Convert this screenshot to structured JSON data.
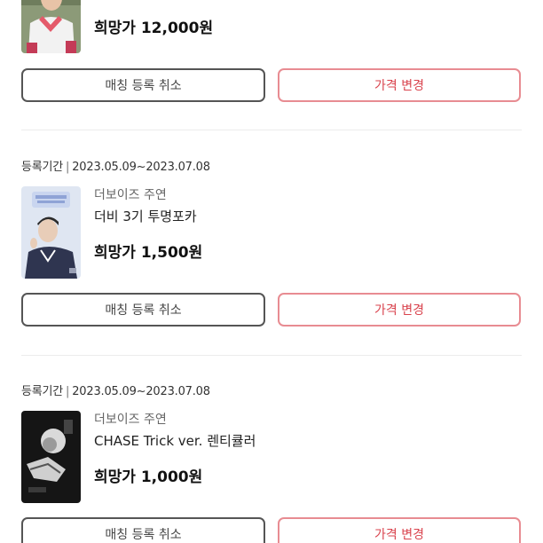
{
  "items": [
    {
      "price": "희망가 12,000원",
      "cancel_label": "매칭 등록 취소",
      "change_label": "가격 변경"
    },
    {
      "period_label": "등록기간",
      "period_sep": "|",
      "period_range": "2023.05.09~2023.07.08",
      "seller": "더보이즈 주연",
      "name": "더비 3기 투명포카",
      "price": "희망가 1,500원",
      "cancel_label": "매칭 등록 취소",
      "change_label": "가격 변경"
    },
    {
      "period_label": "등록기간",
      "period_sep": "|",
      "period_range": "2023.05.09~2023.07.08",
      "seller": "더보이즈 주연",
      "name": "CHASE Trick ver. 렌티큘러",
      "price": "희망가 1,000원",
      "cancel_label": "매칭 등록 취소",
      "change_label": "가격 변경"
    }
  ],
  "colors": {
    "accent_border": "#e88c92",
    "accent_text": "#d9434d",
    "neutral_border": "#555555"
  }
}
